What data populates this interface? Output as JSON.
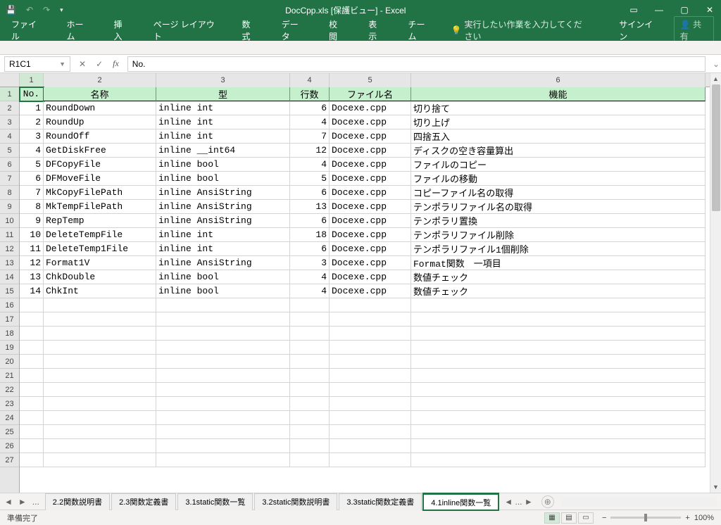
{
  "title": "DocCpp.xls  [保護ビュー] - Excel",
  "ribbon": {
    "tabs": [
      "ファイル",
      "ホーム",
      "挿入",
      "ページ レイアウト",
      "数式",
      "データ",
      "校閲",
      "表示",
      "チーム"
    ],
    "tell": "実行したい作業を入力してください",
    "signin": "サインイン",
    "share": "共有"
  },
  "namebox": "R1C1",
  "formula": "No.",
  "columns": [
    "1",
    "2",
    "3",
    "4",
    "5",
    "6"
  ],
  "headers": [
    "No.",
    "名称",
    "型",
    "行数",
    "ファイル名",
    "機能"
  ],
  "rows": [
    {
      "no": "1",
      "name": "RoundDown",
      "type": "inline int",
      "lines": "6",
      "file": "Docexe.cpp",
      "func": "切り捨て"
    },
    {
      "no": "2",
      "name": "RoundUp",
      "type": "inline int",
      "lines": "4",
      "file": "Docexe.cpp",
      "func": "切り上げ"
    },
    {
      "no": "3",
      "name": "RoundOff",
      "type": "inline int",
      "lines": "7",
      "file": "Docexe.cpp",
      "func": "四捨五入"
    },
    {
      "no": "4",
      "name": "GetDiskFree",
      "type": "inline __int64",
      "lines": "12",
      "file": "Docexe.cpp",
      "func": "ディスクの空き容量算出"
    },
    {
      "no": "5",
      "name": "DFCopyFile",
      "type": "inline bool",
      "lines": "4",
      "file": "Docexe.cpp",
      "func": "ファイルのコピー"
    },
    {
      "no": "6",
      "name": "DFMoveFile",
      "type": "inline bool",
      "lines": "5",
      "file": "Docexe.cpp",
      "func": "ファイルの移動"
    },
    {
      "no": "7",
      "name": "MkCopyFilePath",
      "type": "inline AnsiString",
      "lines": "6",
      "file": "Docexe.cpp",
      "func": "コピーファイル名の取得"
    },
    {
      "no": "8",
      "name": "MkTempFilePath",
      "type": "inline AnsiString",
      "lines": "13",
      "file": "Docexe.cpp",
      "func": "テンポラリファイル名の取得"
    },
    {
      "no": "9",
      "name": "RepTemp",
      "type": "inline AnsiString",
      "lines": "6",
      "file": "Docexe.cpp",
      "func": "テンポラリ置換"
    },
    {
      "no": "10",
      "name": "DeleteTempFile",
      "type": "inline int",
      "lines": "18",
      "file": "Docexe.cpp",
      "func": "テンポラリファイル削除"
    },
    {
      "no": "11",
      "name": "DeleteTemp1File",
      "type": "inline int",
      "lines": "6",
      "file": "Docexe.cpp",
      "func": "テンポラリファイル1個削除"
    },
    {
      "no": "12",
      "name": "Format1V",
      "type": "inline AnsiString",
      "lines": "3",
      "file": "Docexe.cpp",
      "func": "Format関数　一項目"
    },
    {
      "no": "13",
      "name": "ChkDouble",
      "type": "inline bool",
      "lines": "4",
      "file": "Docexe.cpp",
      "func": "数値チェック"
    },
    {
      "no": "14",
      "name": "ChkInt",
      "type": "inline bool",
      "lines": "4",
      "file": "Docexe.cpp",
      "func": "数値チェック"
    }
  ],
  "empty_rows": 12,
  "sheettabs": {
    "left_more": "...",
    "tabs": [
      "2.2関数説明書",
      "2.3関数定義書",
      "3.1static関数一覧",
      "3.2static関数説明書",
      "3.3static関数定義書",
      "4.1inline関数一覧"
    ],
    "active": 5,
    "right_more": "..."
  },
  "status": {
    "ready": "準備完了",
    "zoom": "100%"
  }
}
